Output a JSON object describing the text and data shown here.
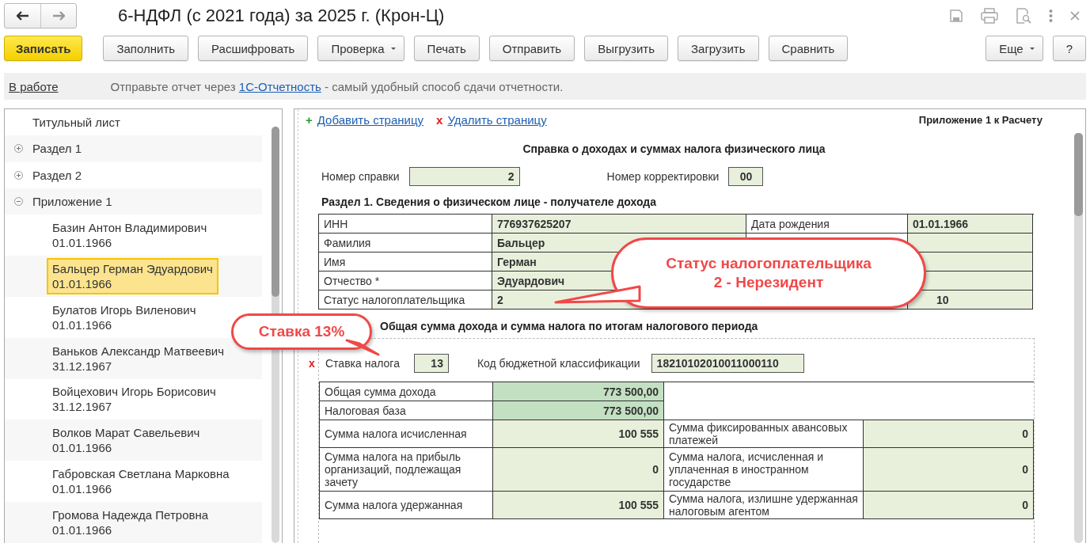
{
  "window": {
    "title": "6-НДФЛ (с 2021 года) за 2025 г. (Крон-Ц)"
  },
  "toolbar": {
    "buttons": [
      {
        "label": "Записать",
        "kind": "primary"
      },
      {
        "label": "Заполнить",
        "kind": "plain"
      },
      {
        "label": "Расшифровать",
        "kind": "plain"
      },
      {
        "label": "Проверка",
        "kind": "dropdown"
      },
      {
        "label": "Печать",
        "kind": "plain"
      },
      {
        "label": "Отправить",
        "kind": "plain"
      },
      {
        "label": "Выгрузить",
        "kind": "plain"
      },
      {
        "label": "Загрузить",
        "kind": "plain"
      },
      {
        "label": "Сравнить",
        "kind": "plain"
      }
    ],
    "right_buttons": [
      {
        "label": "Еще",
        "kind": "dropdown"
      },
      {
        "label": "?",
        "kind": "plain"
      }
    ]
  },
  "info_bar": {
    "status": "В работе",
    "text_before": "Отправьте отчет через",
    "link": "1С-Отчетность",
    "text_after": "- самый удобный способ сдачи отчетности."
  },
  "sidebar": {
    "items": [
      {
        "label": "Титульный лист",
        "kind": "leaf"
      },
      {
        "label": "Раздел 1",
        "kind": "group",
        "expanded": false
      },
      {
        "label": "Раздел 2",
        "kind": "group",
        "expanded": false
      },
      {
        "label": "Приложение 1",
        "kind": "group",
        "expanded": true,
        "children": [
          {
            "name": "Базин Антон Владимирович",
            "date": "01.01.1966",
            "selected": false
          },
          {
            "name": "Бальцер Герман Эдуардович",
            "date": "01.01.1966",
            "selected": true
          },
          {
            "name": "Булатов Игорь Виленович",
            "date": "01.01.1966",
            "selected": false
          },
          {
            "name": "Ваньков Александр Матвеевич",
            "date": "31.12.1967",
            "selected": false
          },
          {
            "name": "Войцехович Игорь Борисович",
            "date": "31.12.1967",
            "selected": false
          },
          {
            "name": "Волков Марат Савельевич",
            "date": "01.01.1966",
            "selected": false
          },
          {
            "name": "Габровская Светлана Марковна",
            "date": "01.01.1966",
            "selected": false
          },
          {
            "name": "Громова Надежда Петровна",
            "date": "01.01.1966",
            "selected": false
          }
        ]
      }
    ]
  },
  "document": {
    "actions": [
      {
        "sign": "+",
        "label": "Добавить страницу",
        "kind": "add"
      },
      {
        "sign": "x",
        "label": "Удалить страницу",
        "kind": "delete"
      }
    ],
    "caption": "Приложение 1 к Расчету",
    "title": "Справка о доходах и суммах налога физического лица",
    "number_fields": [
      {
        "label": "Номер справки",
        "value": "2",
        "kind": "wide"
      },
      {
        "label": "Номер корректировки",
        "value": "00",
        "kind": "short"
      }
    ],
    "section1": {
      "heading": "Раздел 1. Сведения о физическом лице - получателе дохода",
      "rows": [
        {
          "label": "ИНН",
          "value": "776937625207",
          "label2": "Дата рождения",
          "value2": "01.01.1966"
        },
        {
          "label": "Фамилия",
          "value": "Бальцер"
        },
        {
          "label": "Имя",
          "value": "Герман"
        },
        {
          "label": "Отчество *",
          "value": "Эдуардович"
        },
        {
          "label": "Статус налогоплательщика",
          "value": "2",
          "value2": "10"
        }
      ]
    },
    "section2": {
      "heading": "Общая сумма дохода и сумма налога по итогам налогового периода",
      "rate": {
        "sign": "x",
        "label": "Ставка налога",
        "value": "13"
      },
      "kbk": {
        "label": "Код бюджетной классификации",
        "value": "18210102010011000110"
      },
      "rows": [
        {
          "label": "Общая сумма дохода",
          "value": "773 500,00",
          "kind": "base"
        },
        {
          "label": "Налоговая база",
          "value": "773 500,00",
          "kind": "base"
        },
        {
          "label": "Сумма налога исчисленная",
          "value": "100 555",
          "label2": "Сумма фиксированных авансовых платежей",
          "value2": "0",
          "kind": "pair"
        },
        {
          "label": "Сумма налога на прибыль организаций, подлежащая зачету",
          "value": "0",
          "label2": "Сумма налога, исчисленная и уплаченная в иностранном государстве",
          "value2": "0",
          "kind": "pair"
        },
        {
          "label": "Сумма налога удержанная",
          "value": "100 555",
          "label2": "Сумма налога, излишне удержанная налоговым агентом",
          "value2": "0",
          "kind": "pair"
        }
      ]
    }
  },
  "callouts": [
    {
      "lines": [
        "Статус налогоплательщика",
        "2 - Нерезидент"
      ],
      "kind": "status"
    },
    {
      "lines": [
        "Ставка 13%"
      ],
      "kind": "rate"
    }
  ]
}
